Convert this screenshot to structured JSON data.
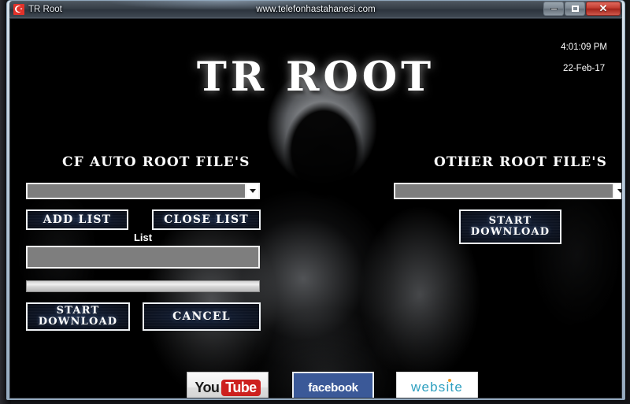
{
  "window": {
    "title": "TR Root",
    "url_caption": "www.telefonhastahanesi.com",
    "icon": "turkish-flag-icon",
    "controls": {
      "minimize": "minimize-icon",
      "maximize": "maximize-icon",
      "close": "✕"
    }
  },
  "app": {
    "title": "TR ROOT",
    "clock": {
      "time": "4:01:09 PM",
      "date": "22-Feb-17"
    },
    "left_panel": {
      "heading": "CF AUTO ROOT FILE'S",
      "combo_value": "",
      "combo_caret": "chevron-down-icon",
      "add_list_label": "ADD LIST",
      "close_list_label": "CLOSE LIST",
      "list_label": "List",
      "list_value": "",
      "progress_percent": 0,
      "start_download_label": "START DOWNLOAD",
      "cancel_label": "CANCEL"
    },
    "right_panel": {
      "heading": "OTHER ROOT FILE'S",
      "combo_value": "",
      "combo_caret": "chevron-down-icon",
      "start_download_label": "START DOWNLOAD"
    },
    "social": {
      "youtube_you": "You",
      "youtube_tube": "Tube",
      "facebook": "facebook",
      "website": "website"
    }
  },
  "colors": {
    "facebook_blue": "#3b5998",
    "youtube_red": "#cd201f",
    "website_teal": "#2d9fbf",
    "website_dot": "#f0a030",
    "button_navy": "#16233c",
    "field_gray": "#7e7e7e"
  }
}
